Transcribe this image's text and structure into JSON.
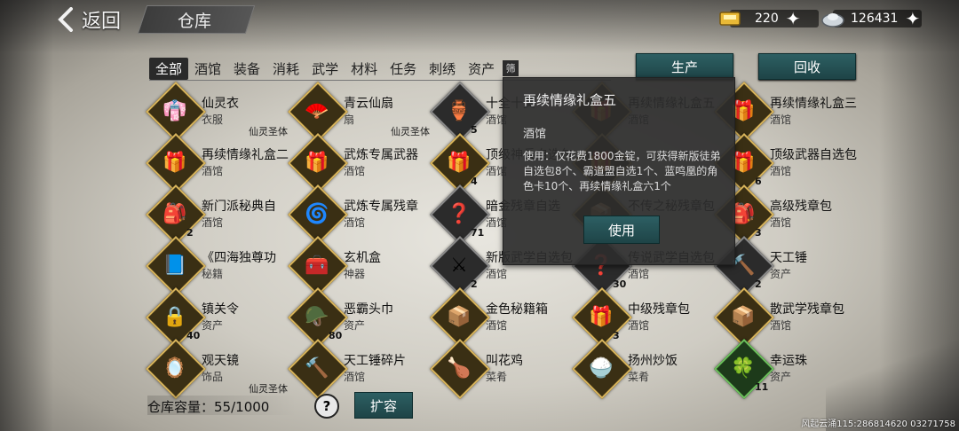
{
  "header": {
    "back_label": "返回",
    "title": "仓库",
    "gold_value": "220",
    "silver_value": "126431"
  },
  "tabs": [
    "全部",
    "酒馆",
    "装备",
    "消耗",
    "武学",
    "材料",
    "任务",
    "刺绣",
    "资产"
  ],
  "tab_more": "筛",
  "buttons": {
    "produce": "生产",
    "recycle": "回收",
    "use": "使用",
    "expand": "扩容"
  },
  "items": [
    {
      "name": "仙灵衣",
      "cat": "衣服",
      "tag": "仙灵圣体",
      "count": "",
      "icon": "👘",
      "frame": "gold"
    },
    {
      "name": "青云仙扇",
      "cat": "扇",
      "tag": "仙灵圣体",
      "count": "",
      "icon": "🪭",
      "frame": "gold"
    },
    {
      "name": "十全十美",
      "cat": "酒馆",
      "tag": "",
      "count": "5",
      "icon": "🏺",
      "frame": "dark"
    },
    {
      "name": "再续情缘礼盒五",
      "cat": "酒馆",
      "tag": "",
      "count": "",
      "icon": "🎁",
      "frame": "gold"
    },
    {
      "name": "再续情缘礼盒三",
      "cat": "酒馆",
      "tag": "",
      "count": "",
      "icon": "🎁",
      "frame": "gold"
    },
    {
      "name": "再续情缘礼盒二",
      "cat": "酒馆",
      "tag": "",
      "count": "",
      "icon": "🎁",
      "frame": "gold"
    },
    {
      "name": "武炼专属武器",
      "cat": "酒馆",
      "tag": "",
      "count": "",
      "icon": "🎁",
      "frame": "gold"
    },
    {
      "name": "顶级神兵自选包",
      "cat": "酒馆",
      "tag": "",
      "count": "4",
      "icon": "🎁",
      "frame": "gold"
    },
    {
      "name": "",
      "cat": "",
      "tag": "",
      "count": "",
      "icon": "🎁",
      "frame": "gold"
    },
    {
      "name": "顶级武器自选包",
      "cat": "酒馆",
      "tag": "",
      "count": "6",
      "icon": "🎁",
      "frame": "gold"
    },
    {
      "name": "新门派秘典自",
      "cat": "酒馆",
      "tag": "",
      "count": "2",
      "icon": "🎒",
      "frame": "gold"
    },
    {
      "name": "武炼专属残章",
      "cat": "酒馆",
      "tag": "",
      "count": "",
      "icon": "🌀",
      "frame": "gold"
    },
    {
      "name": "暗金残章自选",
      "cat": "酒馆",
      "tag": "",
      "count": "71",
      "icon": "❓",
      "frame": "dark"
    },
    {
      "name": "不传之秘残章包",
      "cat": "酒馆",
      "tag": "",
      "count": "",
      "icon": "📦",
      "frame": "gold"
    },
    {
      "name": "高级残章包",
      "cat": "酒馆",
      "tag": "",
      "count": "3",
      "icon": "🎒",
      "frame": "gold"
    },
    {
      "name": "《四海独尊功",
      "cat": "秘籍",
      "tag": "",
      "count": "",
      "icon": "📘",
      "frame": "gold"
    },
    {
      "name": "玄机盒",
      "cat": "神器",
      "tag": "",
      "count": "",
      "icon": "🧰",
      "frame": "gold"
    },
    {
      "name": "新版武学自选包",
      "cat": "酒馆",
      "tag": "",
      "count": "2",
      "icon": "⚔",
      "frame": "dark"
    },
    {
      "name": "传说武学自选包",
      "cat": "酒馆",
      "tag": "",
      "count": "30",
      "icon": "❓",
      "frame": "dark"
    },
    {
      "name": "天工锤",
      "cat": "资产",
      "tag": "",
      "count": "2",
      "icon": "🔨",
      "frame": "dark"
    },
    {
      "name": "镇关令",
      "cat": "资产",
      "tag": "",
      "count": "40",
      "icon": "🔒",
      "frame": "gold"
    },
    {
      "name": "恶霸头巾",
      "cat": "资产",
      "tag": "",
      "count": "80",
      "icon": "🪖",
      "frame": "gold"
    },
    {
      "name": "金色秘籍箱",
      "cat": "酒馆",
      "tag": "",
      "count": "",
      "icon": "📦",
      "frame": "gold"
    },
    {
      "name": "中级残章包",
      "cat": "酒馆",
      "tag": "",
      "count": "3",
      "icon": "🎁",
      "frame": "gold"
    },
    {
      "name": "散武学残章包",
      "cat": "酒馆",
      "tag": "",
      "count": "",
      "icon": "📦",
      "frame": "gold"
    },
    {
      "name": "观天镜",
      "cat": "饰品",
      "tag": "仙灵圣体",
      "count": "",
      "icon": "🪞",
      "frame": "gold"
    },
    {
      "name": "天工锤碎片",
      "cat": "酒馆",
      "tag": "",
      "count": "",
      "icon": "🔨",
      "frame": "gold"
    },
    {
      "name": "叫花鸡",
      "cat": "菜肴",
      "tag": "",
      "count": "",
      "icon": "🍗",
      "frame": "gold"
    },
    {
      "name": "扬州炒饭",
      "cat": "菜肴",
      "tag": "",
      "count": "",
      "icon": "🍚",
      "frame": "gold"
    },
    {
      "name": "幸运珠",
      "cat": "资产",
      "tag": "",
      "count": "11",
      "icon": "🍀",
      "frame": "green"
    }
  ],
  "popup": {
    "title": "再续情缘礼盒五",
    "category": "酒馆",
    "description": "使用：仅花费1800金锭，可获得新版徒弟自选包8个、霸道盟自选1个、蓝鸣凰的角色卡10个、再续情缘礼盒六1个"
  },
  "capacity": {
    "label": "仓库容量：",
    "value": "55/1000"
  },
  "help_symbol": "?",
  "watermark": "风起云涌115:286814620 03271758"
}
